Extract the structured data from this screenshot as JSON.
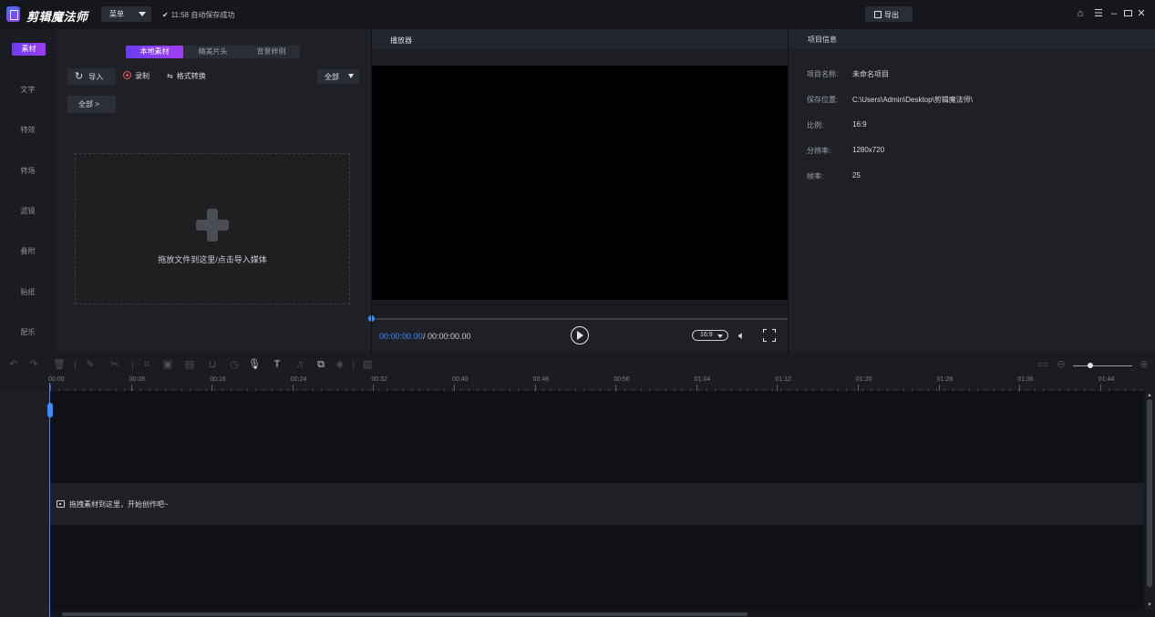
{
  "titlebar": {
    "app_name": "剪辑魔法师",
    "menu_label": "菜单",
    "autosave_text": "11:58 自动保存成功",
    "export_label": "导出",
    "window_icons": [
      "home-icon",
      "hamburger-menu-icon",
      "minimize-icon",
      "restore-icon",
      "close-icon"
    ]
  },
  "sidebar": {
    "items": [
      {
        "label": "素材",
        "active": true
      },
      {
        "label": "文字"
      },
      {
        "label": "特效"
      },
      {
        "label": "转场"
      },
      {
        "label": "滤镜"
      },
      {
        "label": "叠附"
      },
      {
        "label": "贴纸"
      },
      {
        "label": "配乐"
      }
    ]
  },
  "media": {
    "tabs": [
      {
        "label": "本地素材",
        "active": true
      },
      {
        "label": "精美片头"
      },
      {
        "label": "背景样例"
      }
    ],
    "import_label": "导入",
    "record_label": "录制",
    "convert_label": "格式转换",
    "filter_label": "全部",
    "folder_chip_label": "全部 >",
    "dropzone_text": "拖放文件到这里/点击导入媒体"
  },
  "player": {
    "title": "播放器",
    "current_time": "00:00:00.00",
    "total_time": "/ 00:00:00.00",
    "ratio_label": "16:9",
    "progress": 0
  },
  "project_info": {
    "title": "项目信息",
    "rows": [
      {
        "label": "项目名称:",
        "value": "未命名项目"
      },
      {
        "label": "保存位置:",
        "value": "C:\\Users\\Admin\\Desktop\\剪辑魔法师\\"
      },
      {
        "label": "比例:",
        "value": "16:9"
      },
      {
        "label": "分辨率:",
        "value": "1280x720"
      },
      {
        "label": "帧率:",
        "value": "25"
      }
    ]
  },
  "timeline": {
    "ruler_ticks": [
      "00:00",
      "00:08",
      "00:16",
      "00:24",
      "00:32",
      "00:40",
      "00:48",
      "00:56",
      "01:04",
      "01:12",
      "01:20",
      "01:28",
      "01:36",
      "01:44"
    ],
    "hint_text": "拖拽素材到这里，开始创作吧~",
    "zoom_level": 0.25
  },
  "colors": {
    "accent": "#7b3cf2",
    "playhead": "#3c8cff",
    "background": "#15171c"
  }
}
